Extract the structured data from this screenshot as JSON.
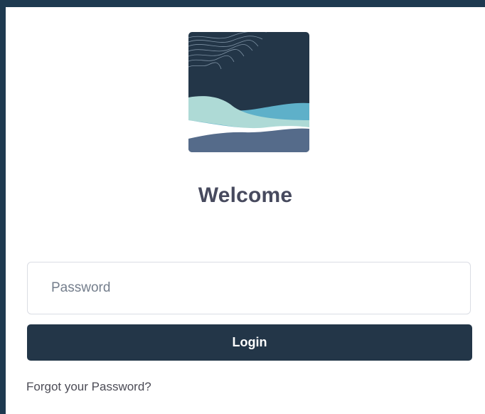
{
  "page": {
    "background_color": "#1e3a50",
    "card_color": "#ffffff"
  },
  "logo": {
    "icon": "wave-landscape-logo",
    "colors": {
      "sky": "#233648",
      "light_wave": "#aedad6",
      "blue_wave": "#5eb0c9",
      "dark_wave": "#556b8a",
      "lines": "#8fa3b5"
    }
  },
  "heading": {
    "title": "Welcome",
    "color": "#474a5e"
  },
  "form": {
    "password_placeholder": "Password",
    "password_value": "",
    "login_label": "Login",
    "login_color": "#233648",
    "forgot_label": "Forgot your Password?"
  }
}
